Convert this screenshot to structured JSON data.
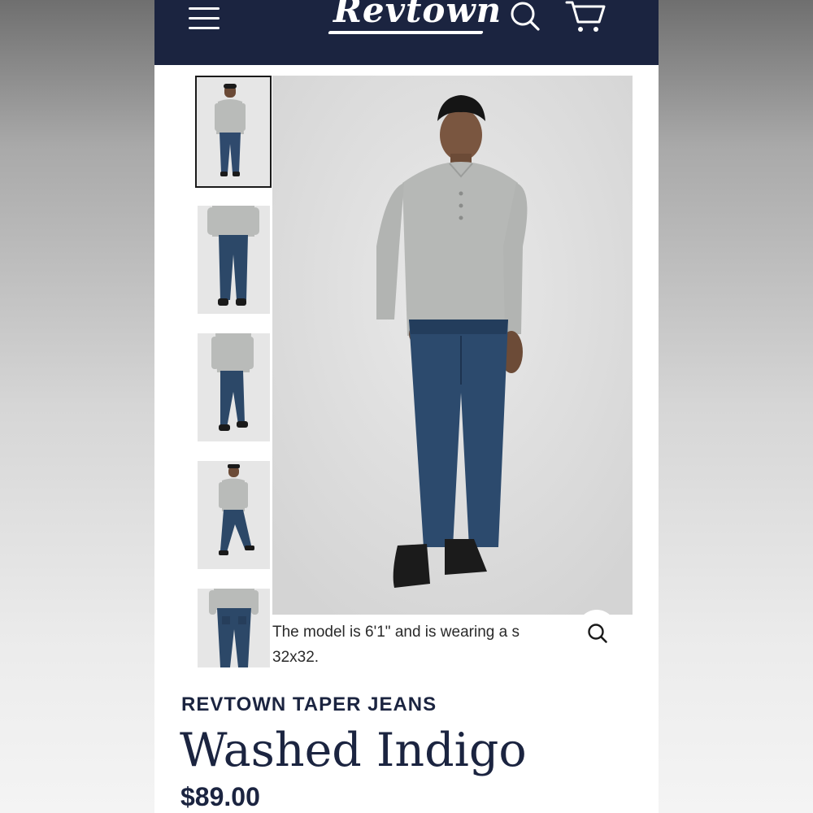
{
  "header": {
    "logo_text": "Revtown",
    "menu_icon": "hamburger-menu-icon",
    "search_icon": "search-icon",
    "cart_icon": "cart-icon",
    "background_color": "#1b2440"
  },
  "gallery": {
    "thumbnails": [
      {
        "view": "front",
        "selected": true
      },
      {
        "view": "front-closeup",
        "selected": false
      },
      {
        "view": "side-step",
        "selected": false
      },
      {
        "view": "walking",
        "selected": false
      },
      {
        "view": "back",
        "selected": false
      }
    ],
    "caption": "The model is 6'1\" and is wearing a s 32x32.",
    "caption_line1": "The model is 6'1\" and is wearing a s",
    "caption_line2": "32x32.",
    "zoom_icon": "zoom-icon"
  },
  "product": {
    "brand": "REVTOWN TAPER JEANS",
    "name": "Washed Indigo",
    "price": "$89.00",
    "text_color": "#1b2440"
  }
}
